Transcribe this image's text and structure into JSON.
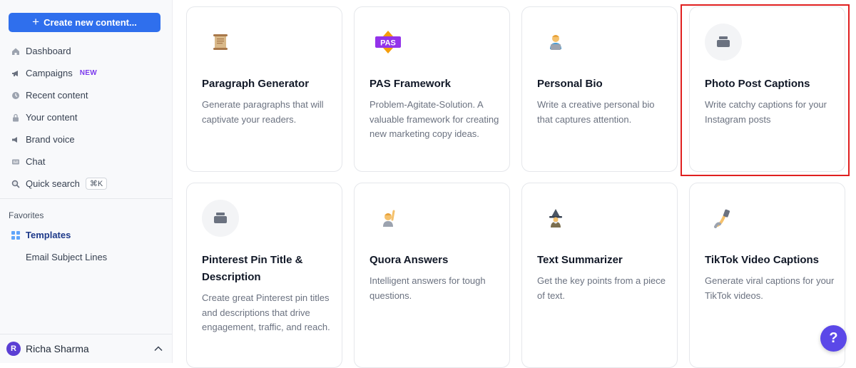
{
  "sidebar": {
    "create_label": "Create new content...",
    "nav": [
      {
        "label": "Dashboard",
        "icon": "home-icon"
      },
      {
        "label": "Campaigns",
        "icon": "megaphone-icon",
        "badge": "NEW"
      },
      {
        "label": "Recent content",
        "icon": "clock-icon"
      },
      {
        "label": "Your content",
        "icon": "lock-icon"
      },
      {
        "label": "Brand voice",
        "icon": "speaker-icon"
      },
      {
        "label": "Chat",
        "icon": "chat-icon"
      },
      {
        "label": "Quick search",
        "icon": "search-icon",
        "shortcut": "⌘K"
      }
    ],
    "favorites_heading": "Favorites",
    "favorites": [
      {
        "label": "Templates",
        "icon": "grid-icon"
      },
      {
        "label": "Email Subject Lines"
      }
    ],
    "user": {
      "initial": "R",
      "name": "Richa Sharma"
    }
  },
  "cards": [
    {
      "title": "Paragraph Generator",
      "desc": "Generate paragraphs that will captivate your readers.",
      "icon": "scroll-icon"
    },
    {
      "title": "PAS Framework",
      "desc": "Problem-Agitate-Solution. A valuable framework for creating new marketing copy ideas.",
      "icon": "pas-icon",
      "icon_text": "PAS"
    },
    {
      "title": "Personal Bio",
      "desc": "Write a creative personal bio that captures attention.",
      "icon": "person-laptop-icon"
    },
    {
      "title": "Photo Post Captions",
      "desc": "Write catchy captions for your Instagram posts",
      "icon": "stack-icon"
    },
    {
      "title": "Pinterest Pin Title & Description",
      "desc": "Create great Pinterest pin titles and descriptions that drive engagement, traffic, and reach.",
      "icon": "stack-icon"
    },
    {
      "title": "Quora Answers",
      "desc": "Intelligent answers for tough questions.",
      "icon": "raising-hand-icon"
    },
    {
      "title": "Text Summarizer",
      "desc": "Get the key points from a piece of text.",
      "icon": "wizard-icon"
    },
    {
      "title": "TikTok Video Captions",
      "desc": "Generate viral captions for your TikTok videos.",
      "icon": "selfie-icon"
    }
  ],
  "help_label": "?",
  "colors": {
    "accent": "#2f6fed",
    "highlight": "#e02020",
    "help": "#5b48e8"
  }
}
